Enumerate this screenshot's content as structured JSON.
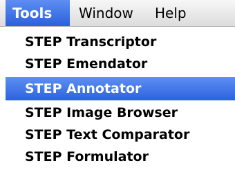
{
  "menubar": {
    "items": [
      {
        "label": "Tools",
        "active": true
      },
      {
        "label": "Window",
        "active": false
      },
      {
        "label": "Help",
        "active": false
      }
    ]
  },
  "tools_menu": {
    "items": [
      {
        "label": "STEP Transcriptor"
      },
      {
        "label": "STEP Emendator"
      },
      {
        "label": "STEP Annotator",
        "highlighted": true
      },
      {
        "label": "STEP Image Browser"
      },
      {
        "label": "STEP Text Comparator"
      },
      {
        "label": "STEP Formulator"
      }
    ]
  },
  "colors": {
    "highlight": "#2b62de",
    "highlight_text": "#ffffff",
    "menubar_background": "#e6e6e6",
    "menu_background": "#ffffff"
  }
}
